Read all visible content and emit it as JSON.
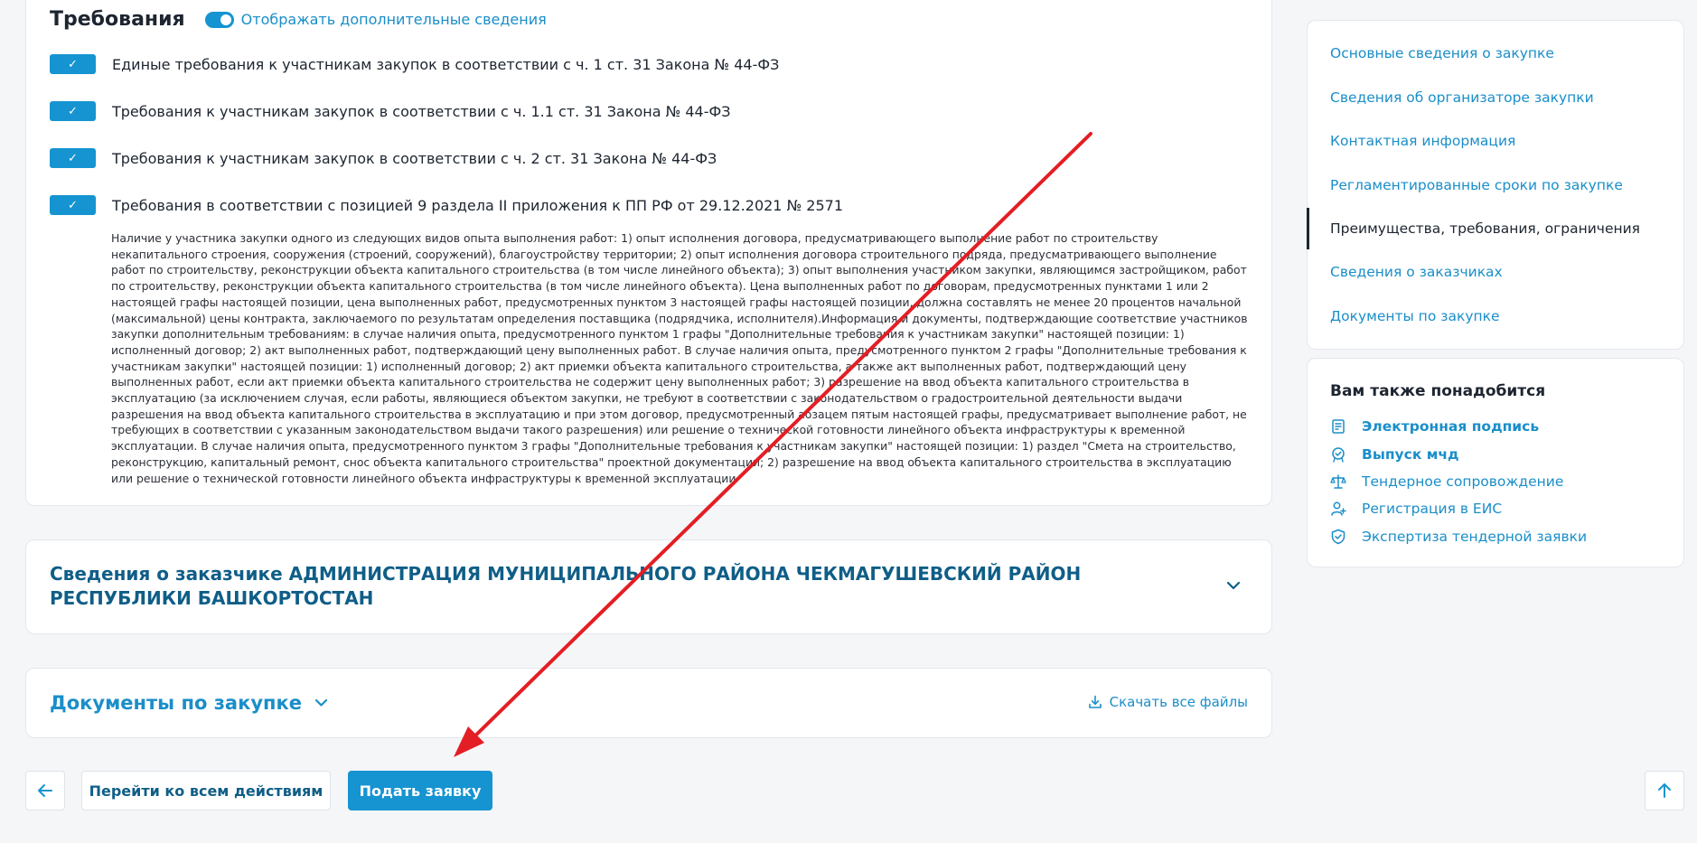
{
  "requirements": {
    "title": "Требования",
    "toggle_label": "Отображать дополнительные сведения",
    "toggle_on": true,
    "items": [
      {
        "checked": true,
        "text": "Единые требования к участникам закупок в соответствии с ч. 1 ст. 31 Закона № 44-ФЗ"
      },
      {
        "checked": true,
        "text": "Требования к участникам закупок в соответствии с ч. 1.1 ст. 31 Закона № 44-ФЗ"
      },
      {
        "checked": true,
        "text": "Требования к участникам закупок в соответствии с ч. 2 ст. 31 Закона № 44-ФЗ"
      },
      {
        "checked": true,
        "text": "Требования в соответствии с позицией 9 раздела II приложения к ПП РФ от 29.12.2021 № 2571"
      }
    ],
    "description": "Наличие у участника закупки одного из следующих видов опыта выполнения работ: 1) опыт исполнения договора, предусматривающего выполнение работ по строительству некапитального строения, сооружения (строений, сооружений), благоустройству территории; 2) опыт исполнения договора строительного подряда, предусматривающего выполнение работ по строительству, реконструкции объекта капитального строительства (в том числе линейного объекта); 3) опыт выполнения участником закупки, являющимся застройщиком, работ по строительству, реконструкции объекта капитального строительства (в том числе линейного объекта). Цена выполненных работ по договорам, предусмотренных пунктами 1 или 2 настоящей графы настоящей позиции, цена выполненных работ, предусмотренных пунктом 3 настоящей графы настоящей позиции, должна составлять не менее 20 процентов начальной (максимальной) цены контракта, заключаемого по результатам определения поставщика (подрядчика, исполнителя).Информация и документы, подтверждающие соответствие участников закупки дополнительным требованиям: в случае наличия опыта, предусмотренного пунктом 1 графы \"Дополнительные требования к участникам закупки\" настоящей позиции: 1) исполненный договор; 2) акт выполненных работ, подтверждающий цену выполненных работ. В случае наличия опыта, предусмотренного пунктом 2 графы \"Дополнительные требования к участникам закупки\" настоящей позиции: 1) исполненный договор; 2) акт приемки объекта капитального строительства, а также акт выполненных работ, подтверждающий цену выполненных работ, если акт приемки объекта капитального строительства не содержит цену выполненных работ; 3) разрешение на ввод объекта капитального строительства в эксплуатацию (за исключением случая, если работы, являющиеся объектом закупки, не требуют в соответствии с законодательством о градостроительной деятельности выдачи разрешения на ввод объекта капитального строительства в эксплуатацию и при этом договор, предусмотренный абзацем пятым настоящей графы, предусматривает выполнение работ, не требующих в соответствии с указанным законодательством выдачи такого разрешения) или решение о технической готовности линейного объекта инфраструктуры к временной эксплуатации. В случае наличия опыта, предусмотренного пунктом 3 графы \"Дополнительные требования к участникам закупки\" настоящей позиции: 1) раздел \"Смета на строительство, реконструкцию, капитальный ремонт, снос объекта капитального строительства\" проектной документации; 2) разрешение на ввод объекта капитального строительства в эксплуатацию или решение о технической готовности линейного объекта инфраструктуры к временной эксплуатации"
  },
  "customer": {
    "title": "Сведения о заказчике АДМИНИСТРАЦИЯ МУНИЦИПАЛЬНОГО РАЙОНА ЧЕКМАГУШЕВСКИЙ РАЙОН РЕСПУБЛИКИ БАШКОРТОСТАН",
    "chevron_icon": "chevron-down-icon"
  },
  "documents": {
    "title": "Документы по закупке",
    "download_all": "Скачать все файлы"
  },
  "buttons": {
    "all_actions": "Перейти ко всем действиям",
    "submit": "Подать заявку"
  },
  "nav": {
    "items": [
      {
        "label": "Основные сведения о закупке",
        "active": false
      },
      {
        "label": "Сведения об организаторе закупки",
        "active": false
      },
      {
        "label": "Контактная информация",
        "active": false
      },
      {
        "label": "Регламентированные сроки по закупке",
        "active": false
      },
      {
        "label": "Преимущества, требования, ограничения",
        "active": true
      },
      {
        "label": "Сведения о заказчиках",
        "active": false
      },
      {
        "label": "Документы по закупке",
        "active": false
      }
    ]
  },
  "also_needed": {
    "title": "Вам также понадобится",
    "items": [
      {
        "label": "Электронная подпись",
        "icon": "certificate-icon",
        "bold": true
      },
      {
        "label": "Выпуск мчд",
        "icon": "badge-check-icon",
        "bold": true
      },
      {
        "label": "Тендерное сопровождение",
        "icon": "scales-icon",
        "bold": false
      },
      {
        "label": "Регистрация в ЕИС",
        "icon": "user-plus-icon",
        "bold": false
      },
      {
        "label": "Экспертиза тендерной заявки",
        "icon": "shield-check-icon",
        "bold": false
      }
    ]
  },
  "colors": {
    "accent": "#1594d1",
    "link": "#1a8ec9",
    "dark_blue": "#0f5e87",
    "annotation_arrow": "#e31e24"
  }
}
